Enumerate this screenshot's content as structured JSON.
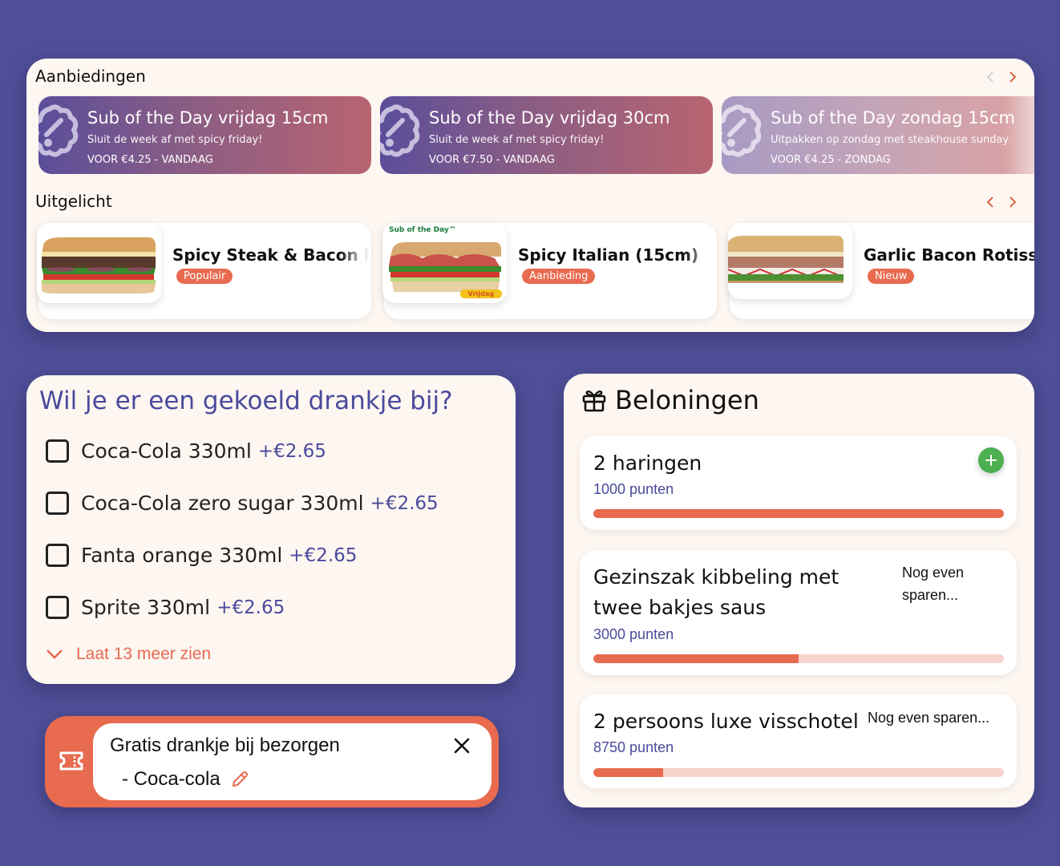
{
  "offers": {
    "title": "Aanbiedingen",
    "items": [
      {
        "title": "Sub of the Day vrijdag 15cm",
        "subtitle": "Sluit de week af met spicy friday!",
        "price_line": "VOOR €4.25  -  VANDAAG"
      },
      {
        "title": "Sub of the Day vrijdag 30cm",
        "subtitle": "Sluit de week af met spicy friday!",
        "price_line": "VOOR €7.50  -  VANDAAG"
      },
      {
        "title": "Sub of the Day zondag 15cm",
        "subtitle": "Uitpakken op zondag met steakhouse sunday",
        "price_line": "VOOR €4.25  -  ZONDAG"
      }
    ],
    "icon": "discount-badge-icon"
  },
  "featured": {
    "title": "Uitgelicht",
    "items": [
      {
        "name": "Spicy Steak & Bacon Melt",
        "badge": "Populair",
        "image": "sandwich-steak-image"
      },
      {
        "name": "Spicy Italian (15cm)",
        "badge": "Aanbieding",
        "image": "sandwich-italian-image",
        "image_label": "Sub of the Day™",
        "image_tag": "Vrijdag"
      },
      {
        "name": "Garlic Bacon Rotisserie",
        "badge": "Nieuw",
        "image": "sandwich-rotisserie-image"
      }
    ]
  },
  "drinks": {
    "title": "Wil je er een gekoeld drankje bij?",
    "items": [
      {
        "label": "Coca-Cola 330ml",
        "price": "+€2.65",
        "checked": false
      },
      {
        "label": "Coca-Cola zero sugar 330ml",
        "price": "+€2.65",
        "checked": false
      },
      {
        "label": "Fanta orange 330ml",
        "price": "+€2.65",
        "checked": false
      },
      {
        "label": "Sprite 330ml",
        "price": "+€2.65",
        "checked": false
      }
    ],
    "show_more": "Laat 13 meer zien"
  },
  "coupon": {
    "title": "Gratis drankje bij bezorgen",
    "item": "- Coca-cola"
  },
  "rewards": {
    "title": "Beloningen",
    "items": [
      {
        "name": "2 haringen",
        "points": "1000 punten",
        "status": "",
        "progress": 1.0,
        "redeemable": true
      },
      {
        "name": "Gezinszak kibbeling met twee bakjes saus",
        "points": "3000 punten",
        "status": "Nog even sparen...",
        "progress": 0.5,
        "redeemable": false
      },
      {
        "name": "2 persoons luxe visschotel",
        "points": "8750 punten",
        "status": "Nog even sparen...",
        "progress": 0.17,
        "redeemable": false
      }
    ]
  },
  "colors": {
    "background": "#4f4f98",
    "panel": "#fdf6f1",
    "accent": "#e86a4f",
    "primary_text": "#4a4a9c",
    "success": "#4caf50"
  }
}
